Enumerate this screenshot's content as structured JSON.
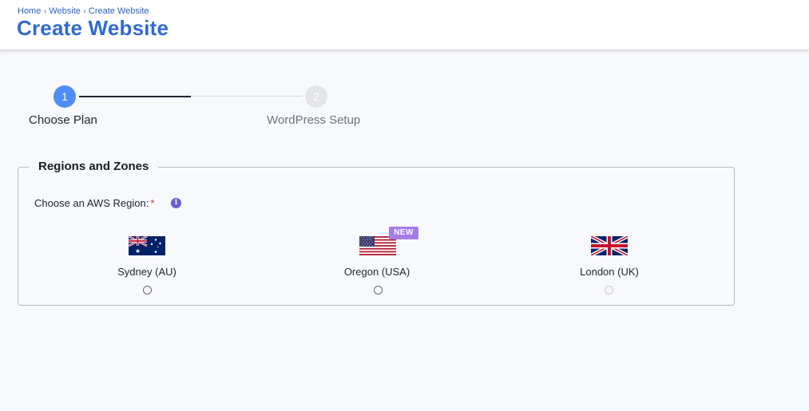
{
  "breadcrumb": {
    "items": [
      "Home",
      "Website",
      "Create Website"
    ]
  },
  "page": {
    "title": "Create Website"
  },
  "stepper": {
    "steps": [
      {
        "number": "1",
        "label": "Choose Plan",
        "state": "active"
      },
      {
        "number": "2",
        "label": "WordPress Setup",
        "state": "inactive"
      }
    ]
  },
  "regions": {
    "legend": "Regions and Zones",
    "field_label": "Choose an AWS Region:",
    "required_mark": "*",
    "info_icon": "info-icon",
    "options": [
      {
        "name": "Sydney (AU)",
        "flag": "australia-flag",
        "selected": false,
        "disabled": false
      },
      {
        "name": "Oregon (USA)",
        "flag": "usa-flag",
        "selected": false,
        "disabled": false,
        "badge": "NEW"
      },
      {
        "name": "London (UK)",
        "flag": "uk-flag",
        "selected": false,
        "disabled": true
      }
    ]
  },
  "colors": {
    "title": "#2f6bd2",
    "breadcrumb": "#2a5fc4",
    "step_active": "#4e8df5",
    "step_inactive": "#e4e5e9",
    "badge": "#a57be6",
    "info_icon": "#6a5cdb",
    "background": "#f8f9fd"
  }
}
